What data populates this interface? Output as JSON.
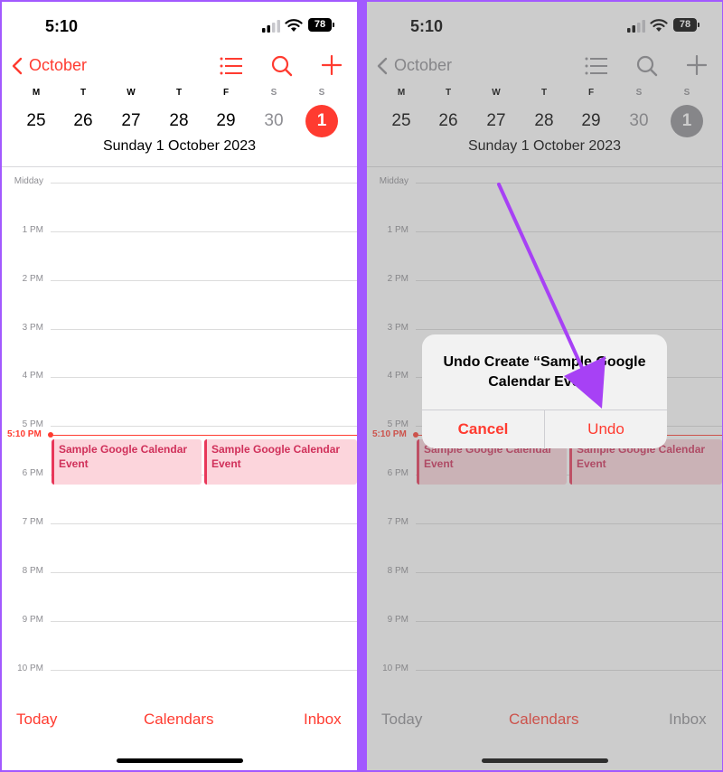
{
  "status": {
    "time": "5:10",
    "battery": "78"
  },
  "nav": {
    "back_label": "October"
  },
  "week": {
    "letters": [
      "M",
      "T",
      "W",
      "T",
      "F",
      "S",
      "S"
    ],
    "days": [
      "25",
      "26",
      "27",
      "28",
      "29",
      "30",
      "1"
    ],
    "selected_index": 6
  },
  "date_title": "Sunday  1 October 2023",
  "timeline": {
    "hours": [
      "Midday",
      "1 PM",
      "2 PM",
      "3 PM",
      "4 PM",
      "5 PM",
      "6 PM",
      "7 PM",
      "8 PM",
      "9 PM",
      "10 PM"
    ],
    "now_label": "5:10 PM"
  },
  "events": [
    {
      "title": "Sample Google Calendar Event"
    },
    {
      "title": "Sample Google Calendar Event"
    }
  ],
  "tabbar": {
    "today": "Today",
    "calendars": "Calendars",
    "inbox": "Inbox"
  },
  "alert": {
    "title": "Undo Create “Sample Google Calendar Event”",
    "cancel": "Cancel",
    "undo": "Undo"
  },
  "colors": {
    "accent": "#ff3b30",
    "event_bg": "#fcd5dc",
    "event_bar": "#e8385a",
    "annotation_arrow": "#a741f5"
  }
}
